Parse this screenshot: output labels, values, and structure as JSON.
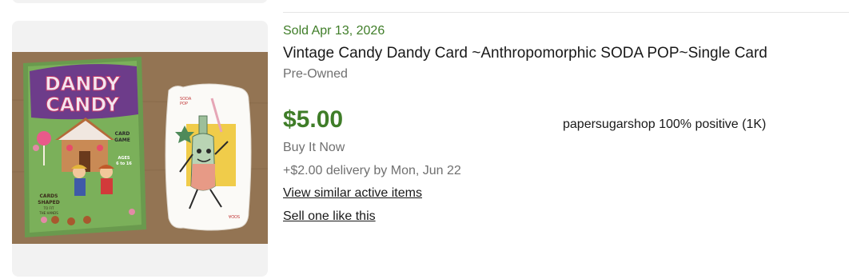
{
  "listing": {
    "sold_date": "Sold Apr 13, 2026",
    "title": "Vintage Candy Dandy Card ~Anthropomorphic SODA POP~Single Card",
    "condition": "Pre-Owned",
    "price": "$5.00",
    "buying_format": "Buy It Now",
    "shipping": "+$2.00 delivery by Mon, Jun 22",
    "links": {
      "similar": "View similar active items",
      "sell": "Sell one like this"
    },
    "seller": "papersugarshop 100% positive (1K)"
  },
  "image": {
    "box_title_line1": "DANDY",
    "box_title_line2": "CANDY",
    "box_subtitle_1": "CARD",
    "box_subtitle_2": "GAME",
    "box_age_1": "AGES",
    "box_age_2": "6 to 16",
    "box_tagline_1": "CARDS",
    "box_tagline_2": "SHAPED",
    "box_tagline_3": "TO FIT",
    "box_tagline_4": "THE HANDS",
    "card_label_1": "SODA",
    "card_label_2": "POP",
    "card_label_bottom": "SODA"
  },
  "colors": {
    "sold_green": "#3f7d28",
    "price_green": "#3f7d28",
    "muted_text": "#707070",
    "panel_bg": "#f2f2f2"
  }
}
